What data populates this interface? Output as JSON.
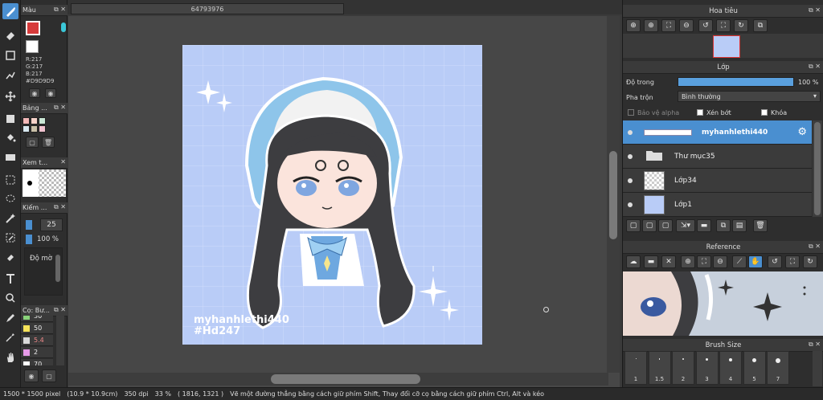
{
  "document_title": "64793976",
  "color_panel": {
    "title": "Màu",
    "r": "R:217",
    "g": "G:217",
    "b": "B:217",
    "hex": "#D9D9D9",
    "main_color": "#d63a3a",
    "sub_color": "#ffffff"
  },
  "palette_panel": {
    "title": "Bảng ...",
    "swatches": [
      "#f2b8b8",
      "#f5d2c8",
      "#c9e6d4",
      "#d8e8f0",
      "#c9c0a8",
      "#f0c2cf"
    ]
  },
  "preview_panel": {
    "title": "Xem t..."
  },
  "brush_control_panel": {
    "title": "Kiếm ...",
    "size_value": "25",
    "opacity_value": "100 %",
    "blend_label": "Độ mờ"
  },
  "color_set_panel": {
    "title": "Cọ: Bư...",
    "items": [
      {
        "value": "30",
        "color": "#8ad37a"
      },
      {
        "value": "50",
        "color": "#f7e35a"
      },
      {
        "value": "5.4",
        "color": "#d9d9d9"
      },
      {
        "value": "2",
        "color": "#e69ae8"
      },
      {
        "value": "70",
        "color": "#ffffff"
      }
    ]
  },
  "canvas": {
    "artwork_bg": "#b9ccf7",
    "watermark_line1": "myhanhlethi440",
    "watermark_line2": "#Hd247"
  },
  "navigator_panel": {
    "title": "Hoa tiêu"
  },
  "layer_panel": {
    "title": "Lớp",
    "opacity_label": "Độ trong",
    "opacity_value": "100 %",
    "opacity_fraction": 1.0,
    "blend_label": "Pha trộn",
    "blend_value": "Bình thường",
    "protect_alpha": "Bảo vệ alpha",
    "clipping": "Xén bớt",
    "lock": "Khóa",
    "layers": [
      {
        "name": "myhanhlethi440",
        "selected": true,
        "type": "text"
      },
      {
        "name": "Thư mục35",
        "selected": false,
        "type": "folder"
      },
      {
        "name": "Lớp34",
        "selected": false,
        "type": "transparent"
      },
      {
        "name": "Lớp1",
        "selected": false,
        "type": "fill"
      }
    ]
  },
  "reference_panel": {
    "title": "Reference"
  },
  "brush_size_panel": {
    "title": "Brush Size",
    "sizes": [
      "1",
      "1.5",
      "2",
      "3",
      "4",
      "5",
      "7"
    ]
  },
  "status_bar": {
    "dimensions": "1500 * 1500 pixel",
    "physical_size": "(10.9 * 10.9cm)",
    "dpi": "350 dpi",
    "zoom": "33 %",
    "cursor": "( 1816, 1321 )",
    "hint": "Vẽ một đường thẳng bằng cách giữ phím Shift, Thay đổi cỡ cọ bằng cách giữ phím Ctrl, Alt và kéo"
  }
}
